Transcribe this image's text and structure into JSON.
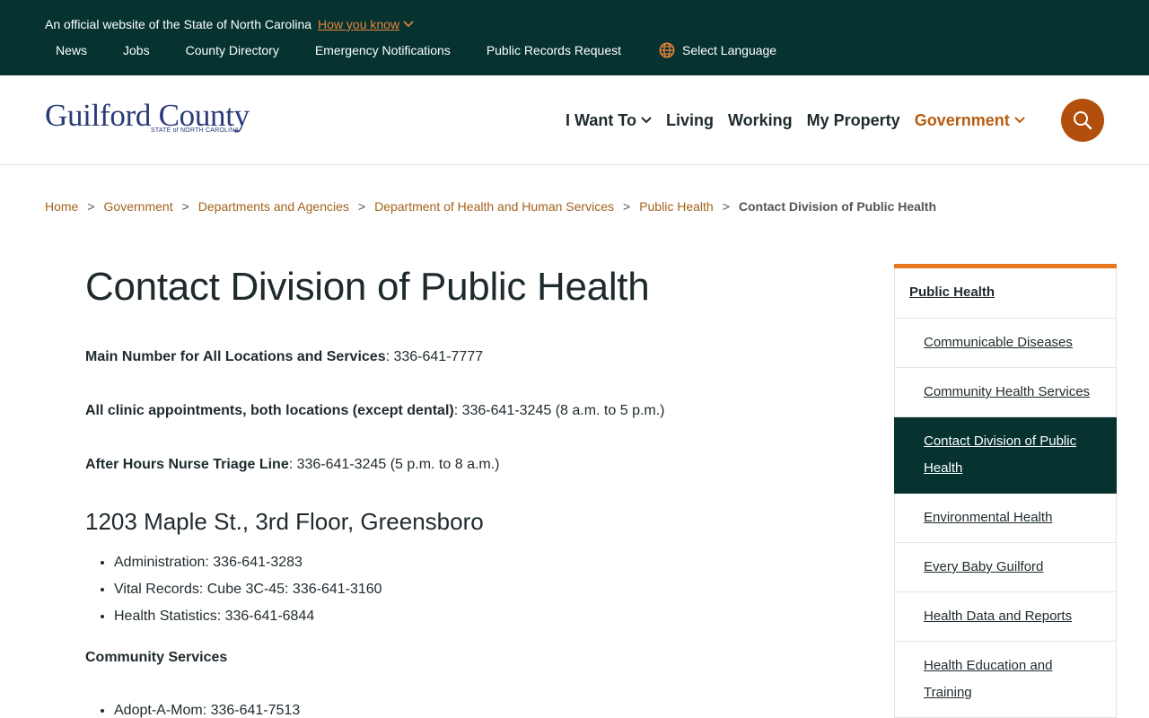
{
  "topbar": {
    "official_text": "An official website of the State of North Carolina",
    "how_you_know": "How you know",
    "links": [
      "News",
      "Jobs",
      "County Directory",
      "Emergency Notifications",
      "Public Records Request"
    ],
    "language": "Select Language",
    "background_color": "#063330",
    "accent_color": "#e8833a"
  },
  "header": {
    "logo_name": "Guilford County",
    "logo_state": "STATE of NORTH CAROLINA",
    "nav": [
      {
        "label": "I Want To",
        "has_dropdown": true
      },
      {
        "label": "Living"
      },
      {
        "label": "Working"
      },
      {
        "label": "My Property"
      },
      {
        "label": "Government",
        "has_dropdown": true,
        "active": true
      }
    ],
    "search_icon": "search-icon",
    "search_button_color": "#b34f0d"
  },
  "breadcrumb": {
    "items": [
      "Home",
      "Government",
      "Departments and Agencies",
      "Department of Health and Human Services",
      "Public Health"
    ],
    "separator": ">",
    "current": "Contact Division of Public Health"
  },
  "content": {
    "title": "Contact Division of Public Health",
    "main_number_label": "Main Number for All Locations and Services",
    "main_number_value": ": 336-641-7777",
    "clinic_label": "All clinic appointments, both locations (except dental)",
    "clinic_value": ": 336-641-3245 (8 a.m. to 5 p.m.)",
    "nurse_label": "After Hours Nurse Triage Line",
    "nurse_value": ": 336-641-3245 (5 p.m. to 8 a.m.)",
    "location_heading": "1203 Maple St., 3rd Floor, Greensboro",
    "location_items": [
      "Administration: 336-641-3283",
      "Vital Records: Cube 3C-45: 336-641-3160",
      "Health Statistics: 336-641-6844"
    ],
    "community_heading": "Community Services",
    "community_items": [
      "Adopt-A-Mom: 336-641-7513"
    ]
  },
  "sidebar": {
    "heading": "Public Health",
    "items": [
      "Communicable Diseases",
      "Community Health Services",
      "Contact Division of Public Health",
      "Environmental Health",
      "Every Baby Guilford",
      "Health Data and Reports",
      "Health Education and Training"
    ],
    "active_item": "Contact Division of Public Health",
    "accent_color": "#e8791e"
  }
}
